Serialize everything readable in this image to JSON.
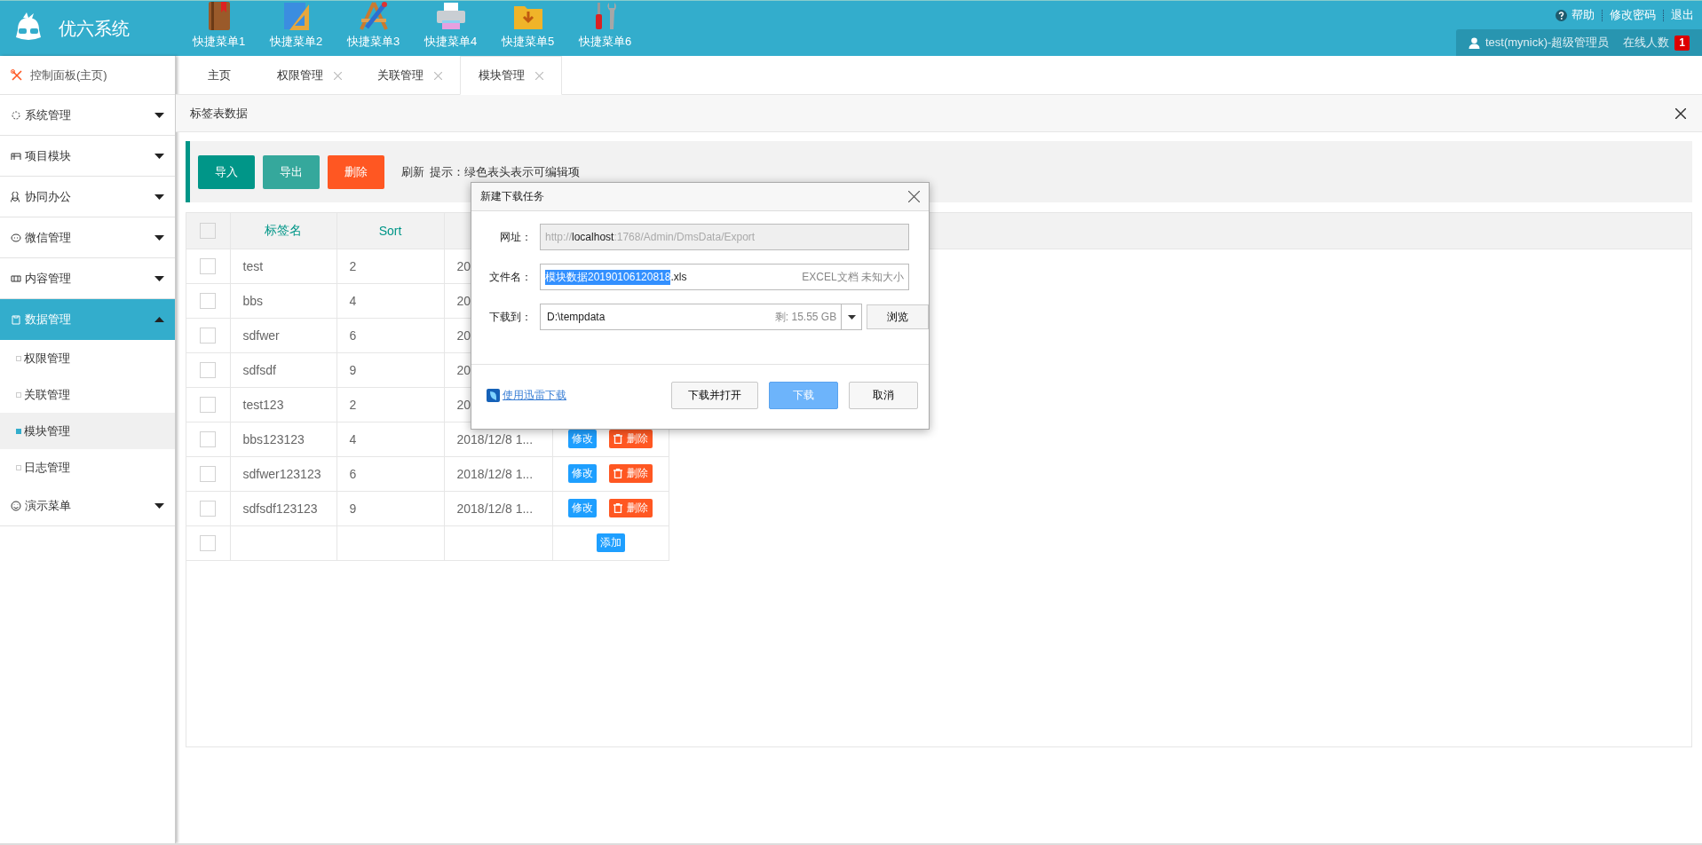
{
  "header": {
    "title": "优六系统",
    "quick_menus": [
      {
        "label": "快捷菜单1"
      },
      {
        "label": "快捷菜单2"
      },
      {
        "label": "快捷菜单3"
      },
      {
        "label": "快捷菜单4"
      },
      {
        "label": "快捷菜单5"
      },
      {
        "label": "快捷菜单6"
      }
    ],
    "links": [
      "帮助",
      "修改密码",
      "退出"
    ],
    "user": "test(mynick)-超级管理员",
    "online_label": "在线人数",
    "online_count": "1"
  },
  "sidebar": {
    "home": "控制面板(主页)",
    "items": [
      {
        "label": "系统管理",
        "expanded": false,
        "selected": false
      },
      {
        "label": "项目模块",
        "expanded": false,
        "selected": false
      },
      {
        "label": "协同办公",
        "expanded": false,
        "selected": false
      },
      {
        "label": "微信管理",
        "expanded": false,
        "selected": false
      },
      {
        "label": "内容管理",
        "expanded": false,
        "selected": false
      },
      {
        "label": "数据管理",
        "expanded": true,
        "selected": true,
        "children": [
          {
            "label": "权限管理",
            "selected": false
          },
          {
            "label": "关联管理",
            "selected": false
          },
          {
            "label": "模块管理",
            "selected": true
          },
          {
            "label": "日志管理",
            "selected": false
          }
        ]
      },
      {
        "label": "演示菜单",
        "expanded": false,
        "selected": false
      }
    ]
  },
  "tabs": [
    {
      "label": "主页",
      "selected": false,
      "closable": false
    },
    {
      "label": "权限管理",
      "selected": false,
      "closable": true
    },
    {
      "label": "关联管理",
      "selected": false,
      "closable": true
    },
    {
      "label": "模块管理",
      "selected": true,
      "closable": true
    }
  ],
  "panel": {
    "title": "标签表数据",
    "toolbar": {
      "buttons": [
        {
          "label": "导入",
          "kind": "primary"
        },
        {
          "label": "导出",
          "kind": "secondary"
        },
        {
          "label": "删除",
          "kind": "danger"
        }
      ],
      "refresh": "刷新",
      "hint": "提示：绿色表头表示可编辑项"
    },
    "table": {
      "header_checked": false,
      "columns": [
        "标签名",
        "Sort"
      ],
      "rows": [
        {
          "kind": "data",
          "checked": false,
          "name": "test",
          "sort": "2",
          "date": "20"
        },
        {
          "kind": "data",
          "checked": false,
          "name": "bbs",
          "sort": "4",
          "date": "20"
        },
        {
          "kind": "data",
          "checked": false,
          "name": "sdfwer",
          "sort": "6",
          "date": "20"
        },
        {
          "kind": "data",
          "checked": false,
          "name": "sdfsdf",
          "sort": "9",
          "date": "20"
        },
        {
          "kind": "data",
          "checked": false,
          "name": "test123",
          "sort": "2",
          "date": "20"
        },
        {
          "kind": "data",
          "checked": false,
          "name": "bbs123123",
          "sort": "4",
          "date": "2018/12/8 1...",
          "edit": "修改",
          "delete": "删除"
        },
        {
          "kind": "data",
          "checked": false,
          "name": "sdfwer123123",
          "sort": "6",
          "date": "2018/12/8 1...",
          "edit": "修改",
          "delete": "删除"
        },
        {
          "kind": "data",
          "checked": false,
          "name": "sdfsdf123123",
          "sort": "9",
          "date": "2018/12/8 1...",
          "edit": "修改",
          "delete": "删除"
        },
        {
          "kind": "add",
          "checked": false,
          "add": "添加"
        }
      ]
    }
  },
  "dialog": {
    "title": "新建下载任务",
    "url_label": "网址：",
    "url_scheme": "http://",
    "url_host": "localhost",
    "url_path": ":1768/Admin/DmsData/Export",
    "filename_label": "文件名：",
    "filename_selected": "模块数据20190106120818",
    "filename_rest": ".xls",
    "file_info": "EXCEL文档 未知大小",
    "saveto_label": "下载到：",
    "saveto_path": "D:\\tempdata",
    "free_space": "剩: 15.55 GB",
    "browse": "浏览",
    "thunder_link": "使用迅雷下载",
    "buttons": [
      {
        "label": "下载并打开",
        "kind": "normal"
      },
      {
        "label": "下载",
        "kind": "primary"
      },
      {
        "label": "取消",
        "kind": "normal"
      }
    ]
  }
}
